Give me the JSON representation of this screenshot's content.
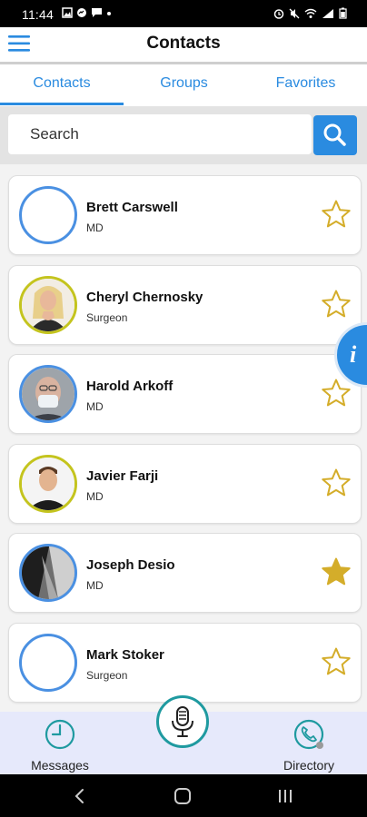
{
  "status_bar": {
    "time": "11:44"
  },
  "header": {
    "title": "Contacts"
  },
  "tabs": [
    {
      "label": "Contacts",
      "active": true
    },
    {
      "label": "Groups",
      "active": false
    },
    {
      "label": "Favorites",
      "active": false
    }
  ],
  "search": {
    "placeholder": "Search",
    "value": ""
  },
  "contacts": [
    {
      "name": "Brett Carswell",
      "role": "MD",
      "avatar": "empty",
      "favorite": false
    },
    {
      "name": "Cheryl Chernosky",
      "role": "Surgeon",
      "avatar": "photo",
      "favorite": false
    },
    {
      "name": "Harold Arkoff",
      "role": "MD",
      "avatar": "photo",
      "favorite": false
    },
    {
      "name": "Javier Farji",
      "role": "MD",
      "avatar": "photo",
      "favorite": false
    },
    {
      "name": "Joseph Desio",
      "role": "MD",
      "avatar": "photo",
      "favorite": true
    },
    {
      "name": "Mark Stoker",
      "role": "Surgeon",
      "avatar": "empty",
      "favorite": false
    }
  ],
  "bottom_nav": {
    "messages_label": "Messages",
    "directory_label": "Directory"
  },
  "colors": {
    "accent": "#2a8be0",
    "star": "#d4ad2a",
    "avatar_blue": "#4a90e2",
    "avatar_yellow": "#c4c41e",
    "mic_ring": "#1f9aa0",
    "bottom_bar": "#e6e9fb"
  }
}
